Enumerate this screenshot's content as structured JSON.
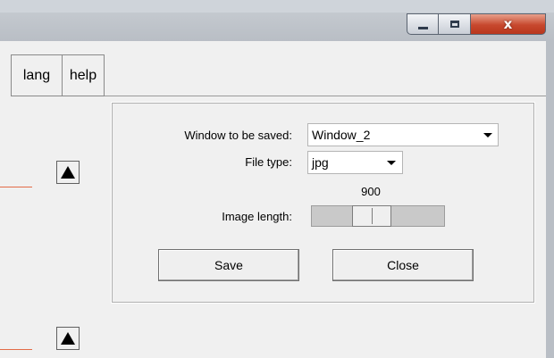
{
  "window": {
    "minimize_icon": "minimize-icon",
    "maximize_icon": "maximize-icon",
    "close_icon": "close-icon",
    "close_glyph": "x"
  },
  "menubar": {
    "lang_label": "lang",
    "help_label": "help"
  },
  "side_controls": {
    "arrow_icon": "triangle-up-icon",
    "line_color": "#e36b47"
  },
  "save_dialog": {
    "window_label": "Window to be saved:",
    "window_value": "Window_2",
    "file_type_label": "File type:",
    "file_type_value": "jpg",
    "image_length_label": "Image length:",
    "image_length_value": "900",
    "save_label": "Save",
    "close_label": "Close"
  }
}
